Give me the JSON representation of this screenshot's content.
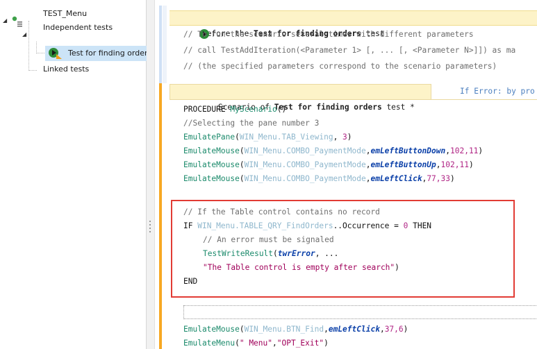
{
  "tree": {
    "root": "TEST_Menu",
    "group_independent": "Independent tests",
    "test_item": "Test for finding order",
    "group_linked": "Linked tests"
  },
  "editor": {
    "before_section": {
      "prefix": "Before the ",
      "name": "Test for finding orders",
      "suffix": " test"
    },
    "before_comments": [
      "// To run the scenario several times with different parameters",
      "// call TestAddIteration(<Parameter 1> [, ... [, <Parameter N>]]) as ma",
      "// (the specified parameters correspond to the scenario parameters)"
    ],
    "scenario_tab": {
      "prefix": "Scenario of ",
      "name": "Test for finding orders",
      "suffix": " test *"
    },
    "on_error_tab": "If Error: by pro",
    "code": {
      "procedure_kw": "PROCEDURE ",
      "procedure_name": "MyScenario",
      "procedure_args": "()",
      "comment_pane": "//Selecting the pane number 3",
      "l1": {
        "fn": "EmulatePane",
        "ctl": "WIN_Menu.",
        "ctl2": "TAB_Viewing",
        "rest": ", ",
        "num": "3",
        "end": ")"
      },
      "l2": {
        "fn": "EmulateMouse",
        "ctl": "WIN_Menu.",
        "ctl2": "COMBO_PaymentMode",
        "param": "emLeftButtonDown",
        "nums": "102,11"
      },
      "l3": {
        "fn": "EmulateMouse",
        "ctl": "WIN_Menu.",
        "ctl2": "COMBO_PaymentMode",
        "param": "emLeftButtonUp",
        "nums": "102,11"
      },
      "l4": {
        "fn": "EmulateMouse",
        "ctl": "WIN_Menu.",
        "ctl2": "COMBO_PaymentMode",
        "param": "emLeftClick",
        "nums": "77,33"
      },
      "hl_comment": "// If the Table control contains no record",
      "hl_if_kw": "IF ",
      "hl_if_ctl": "WIN_Menu.",
      "hl_if_ctl2": "TABLE_QRY_FindOrders",
      "hl_if_prop": "..Occurrence = ",
      "hl_if_num": "0",
      "hl_if_then": " THEN",
      "hl_err_comment": "// An error must be signaled",
      "hl_fn": "TestWriteResult",
      "hl_param": "twrError",
      "hl_cont": ", ...",
      "hl_str": "\"The Table control is empty after search\"",
      "hl_end_paren": ")",
      "hl_end": "END",
      "l5": {
        "fn": "EmulateMouse",
        "ctl": "WIN_Menu.",
        "ctl2": "BTN_Find",
        "param": "emLeftClick",
        "nums": "37,6"
      },
      "l6": {
        "fn": "EmulateMenu",
        "str1": "\" Menu\"",
        "str2": "\"OPT_Exit\""
      }
    }
  },
  "colors": {
    "selection": "#cce4f7",
    "section_header": "#fdf3c8",
    "gutter_orange": "#f7a823",
    "gutter_blue": "#cfe0f5",
    "highlight_box": "#e23b34"
  }
}
